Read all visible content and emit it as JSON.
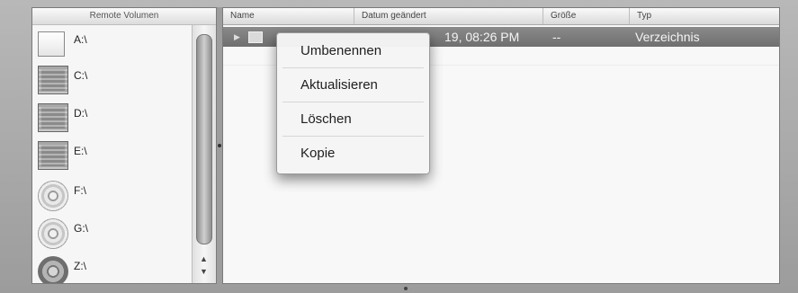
{
  "left_panel": {
    "header": "Remote Volumen",
    "volumes": [
      {
        "label": "A:\\",
        "icon": "floppy-drive-icon"
      },
      {
        "label": "C:\\",
        "icon": "hard-drive-icon"
      },
      {
        "label": "D:\\",
        "icon": "hard-drive-icon"
      },
      {
        "label": "E:\\",
        "icon": "hard-drive-icon"
      },
      {
        "label": "F:\\",
        "icon": "cd-drive-icon"
      },
      {
        "label": "G:\\",
        "icon": "cd-drive-icon"
      },
      {
        "label": "Z:\\",
        "icon": "network-drive-icon"
      }
    ]
  },
  "file_list": {
    "columns": {
      "name": "Name",
      "date": "Datum geändert",
      "size": "Größe",
      "type": "Typ"
    },
    "selected_row": {
      "date": "19, 08:26 PM",
      "size": "--",
      "type": "Verzeichnis"
    }
  },
  "context_menu": {
    "items": [
      "Umbenennen",
      "Aktualisieren",
      "Löschen",
      "Kopie"
    ]
  }
}
